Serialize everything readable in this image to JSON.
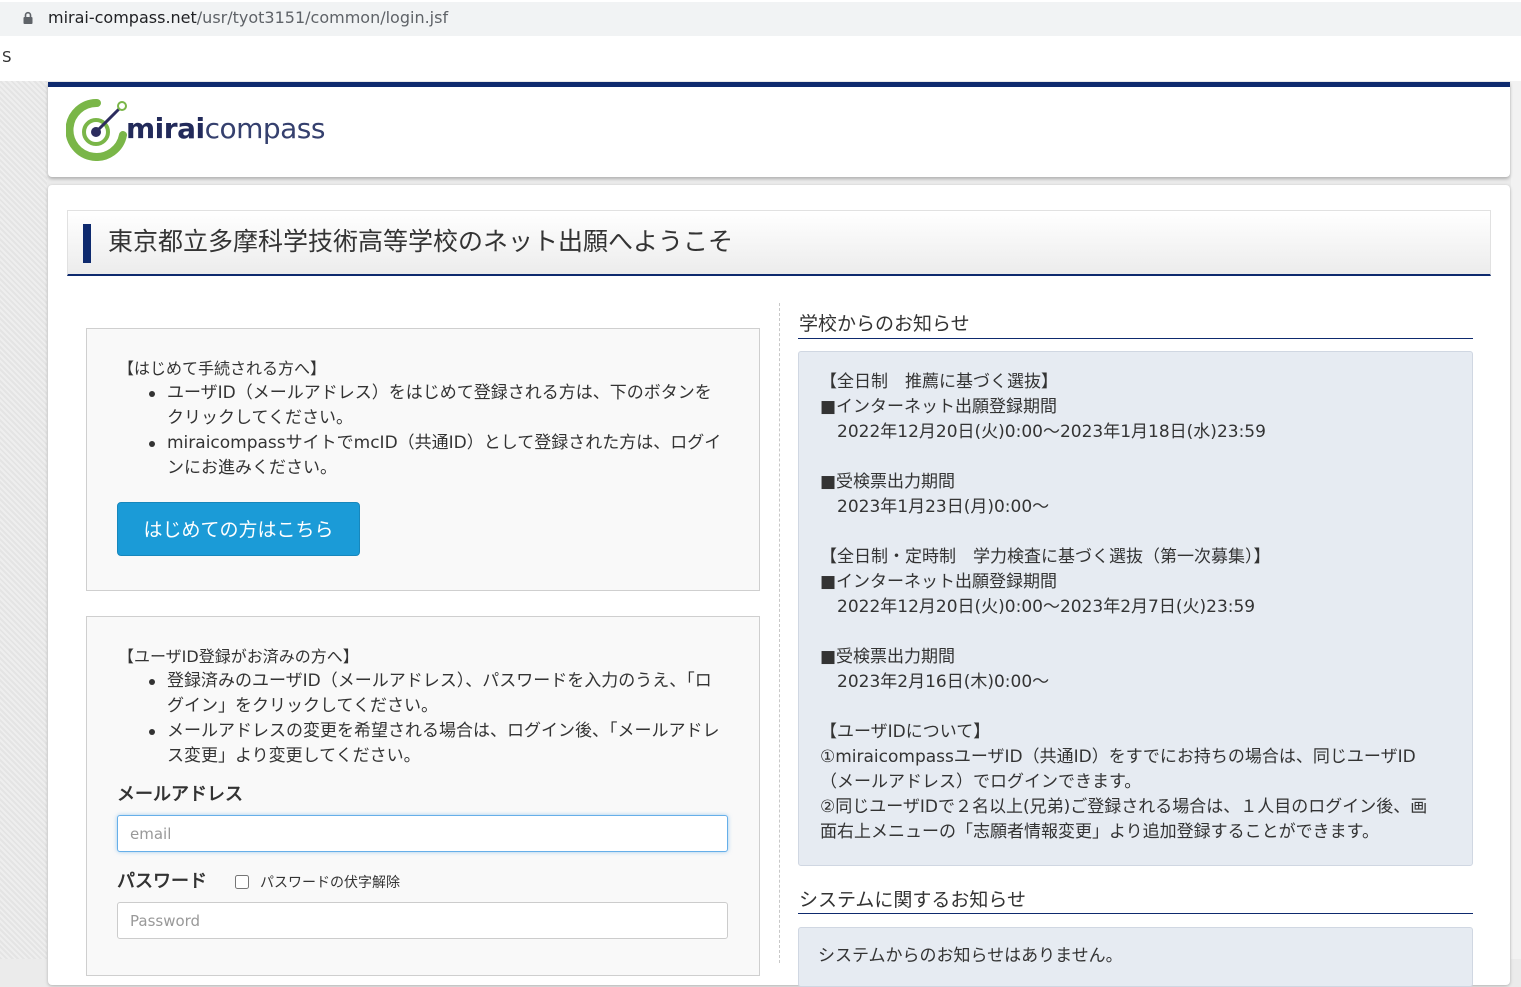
{
  "browser": {
    "url_domain": "mirai-compass.net",
    "url_path": "/usr/tyot3151/common/login.jsf",
    "bookmark_text": "S"
  },
  "logo": {
    "bold": "mirai",
    "light": "compass"
  },
  "page_title": "東京都立多摩科学技術高等学校のネット出願へようこそ",
  "first_time": {
    "heading": "【はじめて手続される方へ】",
    "bullets": [
      "ユーザID（メールアドレス）をはじめて登録される方は、下のボタンをクリックしてください。",
      "miraicompassサイトでmcID（共通ID）として登録された方は、ログインにお進みください。"
    ],
    "button_label": "はじめての方はこちら"
  },
  "registered": {
    "heading": "【ユーザID登録がお済みの方へ】",
    "bullets": [
      "登録済みのユーザID（メールアドレス）、パスワードを入力のうえ、「ログイン」をクリックしてください。",
      "メールアドレスの変更を希望される場合は、ログイン後、「メールアドレス変更」より変更してください。"
    ],
    "email_label": "メールアドレス",
    "email_placeholder": "email",
    "email_value": "",
    "password_label": "パスワード",
    "password_placeholder": "Password",
    "show_password_label": "パスワードの伏字解除",
    "show_password_checked": false
  },
  "school_notice": {
    "title": "学校からのお知らせ",
    "lines": [
      "【全日制　推薦に基づく選抜】",
      "■インターネット出願登録期間",
      "　2022年12月20日(火)0:00～2023年1月18日(水)23:59",
      "",
      "■受検票出力期間",
      "　2023年1月23日(月)0:00～",
      "",
      "【全日制・定時制　学力検査に基づく選抜（第一次募集）】",
      "■インターネット出願登録期間",
      "　2022年12月20日(火)0:00～2023年2月7日(火)23:59",
      "",
      "■受検票出力期間",
      "　2023年2月16日(木)0:00～",
      "",
      "【ユーザIDについて】",
      "①miraicompassユーザID（共通ID）をすでにお持ちの場合は、同じユーザID",
      "（メールアドレス）でログインできます。",
      "②同じユーザIDで２名以上(兄弟)ご登録される場合は、１人目のログイン後、画",
      "面右上メニューの「志願者情報変更」より追加登録することができます。"
    ]
  },
  "system_notice": {
    "title": "システムに関するお知らせ",
    "text": "システムからのお知らせはありません。"
  },
  "colors": {
    "brand_navy": "#0e2a6e",
    "button_blue": "#1b9bd7",
    "notice_bg": "#e6ebf2",
    "logo_green": "#7ab648"
  }
}
